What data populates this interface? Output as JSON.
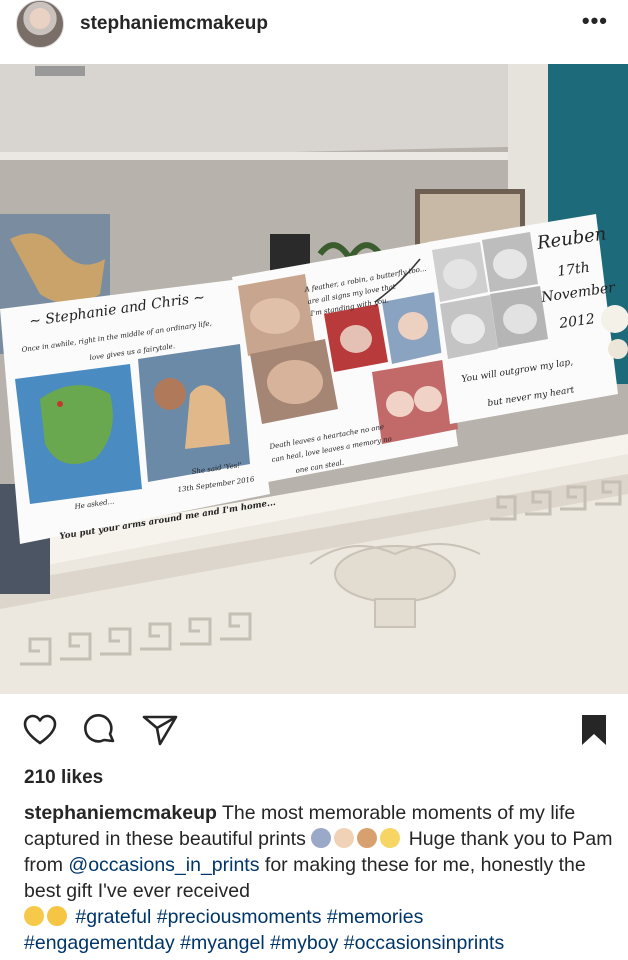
{
  "post": {
    "username": "stephaniemcmakeup",
    "more_icon": "more-horizontal-icon",
    "likes": "210 likes",
    "caption_username": "stephaniemcmakeup",
    "caption_1": "The most memorable moments of my life captured in these beautiful prints",
    "caption_2": "Huge thank you to Pam from",
    "mention": "@occasions_in_prints",
    "caption_3": "for making these for me, honestly the best gift I've ever received",
    "hashtags_line1": "#grateful #preciousmoments #memories",
    "hashtags_line2": "#engagementday #myangel #myboy #occasionsinprints"
  },
  "prints": {
    "left": {
      "title": "~ Stephanie and Chris ~",
      "line1": "Once in awhile, right in the middle of an ordinary life,",
      "line2": "love gives us a fairytale.",
      "he_asked": "He asked...",
      "she_said": "She said 'Yes!'",
      "date": "13th September 2016",
      "footer": "You put your arms around me and I'm home..."
    },
    "middle": {
      "quote1": "A feather, a robin, a butterfly too...",
      "quote2": "are all signs my love that",
      "quote3": "I'm standing with you.",
      "quote4": "Death leaves a heartache no one",
      "quote5": "can heal, love leaves a memory no",
      "quote6": "one can steal."
    },
    "right": {
      "name": "Reuben",
      "day": "17th",
      "month": "November",
      "year": "2012",
      "line1": "You will outgrow my lap,",
      "line2": "but never my heart"
    }
  },
  "colors": {
    "wall": "#b9b4ad",
    "teal_wall": "#1d6a7a",
    "marble": "#ece7df",
    "hashtag": "#003569"
  }
}
